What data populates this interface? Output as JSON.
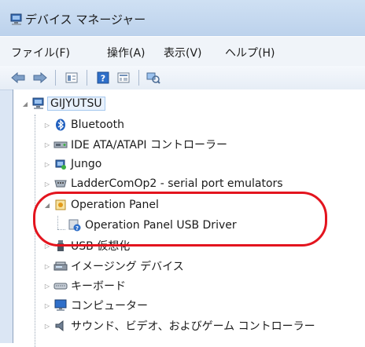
{
  "window": {
    "title": "デバイス マネージャー"
  },
  "menu": [
    "ファイル(F)",
    "操作(A)",
    "表示(V)",
    "ヘルプ(H)"
  ],
  "toolbar": {
    "buttons": [
      "back-arrow-icon",
      "forward-arrow-icon",
      "properties-icon",
      "help-icon",
      "device-view-icon",
      "scan-hardware-icon"
    ]
  },
  "tree": {
    "root": "GIJYUTSU",
    "items": [
      "Bluetooth",
      "IDE ATA/ATAPI コントローラー",
      "Jungo",
      "LadderComOp2 - serial port emulators",
      "Operation Panel",
      "Operation Panel USB Driver",
      "USB 仮想化",
      "イメージング デバイス",
      "キーボード",
      "コンピューター",
      "サウンド、ビデオ、およびゲーム コントローラー"
    ]
  },
  "colors": {
    "highlight": "#e3141e",
    "selection": "#e8f1fc"
  }
}
